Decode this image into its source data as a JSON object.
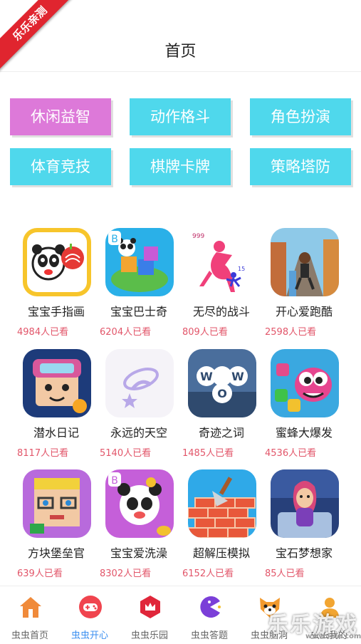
{
  "watermark_ribbon": "乐乐亲测",
  "header": {
    "title": "首页"
  },
  "categories": [
    {
      "label": "休闲益智",
      "active": true
    },
    {
      "label": "动作格斗"
    },
    {
      "label": "角色扮演"
    },
    {
      "label": "体育竞技"
    },
    {
      "label": "棋牌卡牌"
    },
    {
      "label": "策略塔防"
    }
  ],
  "apps": [
    {
      "name": "宝宝手指画",
      "views": "4984人已看",
      "icon": "panda-fingerpaint-icon"
    },
    {
      "name": "宝宝巴士奇",
      "views": "6204人已看",
      "icon": "panda-puzzle-island-icon"
    },
    {
      "name": "无尽的战斗",
      "views": "809人已看",
      "icon": "giant-stickman-icon"
    },
    {
      "name": "开心爱跑酷",
      "views": "2598人已看",
      "icon": "runner-street-icon"
    },
    {
      "name": "潜水日记",
      "views": "8117人已看",
      "icon": "diver-character-icon"
    },
    {
      "name": "永远的天空",
      "views": "5140人已看",
      "icon": "sky-logo-icon"
    },
    {
      "name": "奇迹之词",
      "views": "1485人已看",
      "icon": "wow-word-icon"
    },
    {
      "name": "蜜蜂大爆发",
      "views": "4536人已看",
      "icon": "bee-gems-icon"
    },
    {
      "name": "方块堡垒官",
      "views": "639人已看",
      "icon": "block-character-icon"
    },
    {
      "name": "宝宝爱洗澡",
      "views": "8302人已看",
      "icon": "panda-bath-icon"
    },
    {
      "name": "超解压模拟",
      "views": "6152人已看",
      "icon": "brick-trowel-icon"
    },
    {
      "name": "宝石梦想家",
      "views": "85人已看",
      "icon": "dreamer-girl-icon"
    }
  ],
  "tabbar": [
    {
      "label": "虫虫首页",
      "icon": "home-icon"
    },
    {
      "label": "虫虫开心",
      "icon": "gamepad-icon",
      "active": true
    },
    {
      "label": "虫虫乐园",
      "icon": "crown-hexagon-icon"
    },
    {
      "label": "虫虫答题",
      "icon": "pacman-icon"
    },
    {
      "label": "虫虫脑洞",
      "icon": "fox-face-icon"
    },
    {
      "label": "虫虫我的",
      "icon": "user-icon"
    }
  ],
  "site_watermark": {
    "text": "乐乐游戏",
    "url": "www.lele.com"
  },
  "colors": {
    "active_category": "#dd79d9",
    "category": "#4fd8ec",
    "views": "#e2566a",
    "active_tab": "#3b8ff0",
    "ribbon": "#e0252f"
  }
}
